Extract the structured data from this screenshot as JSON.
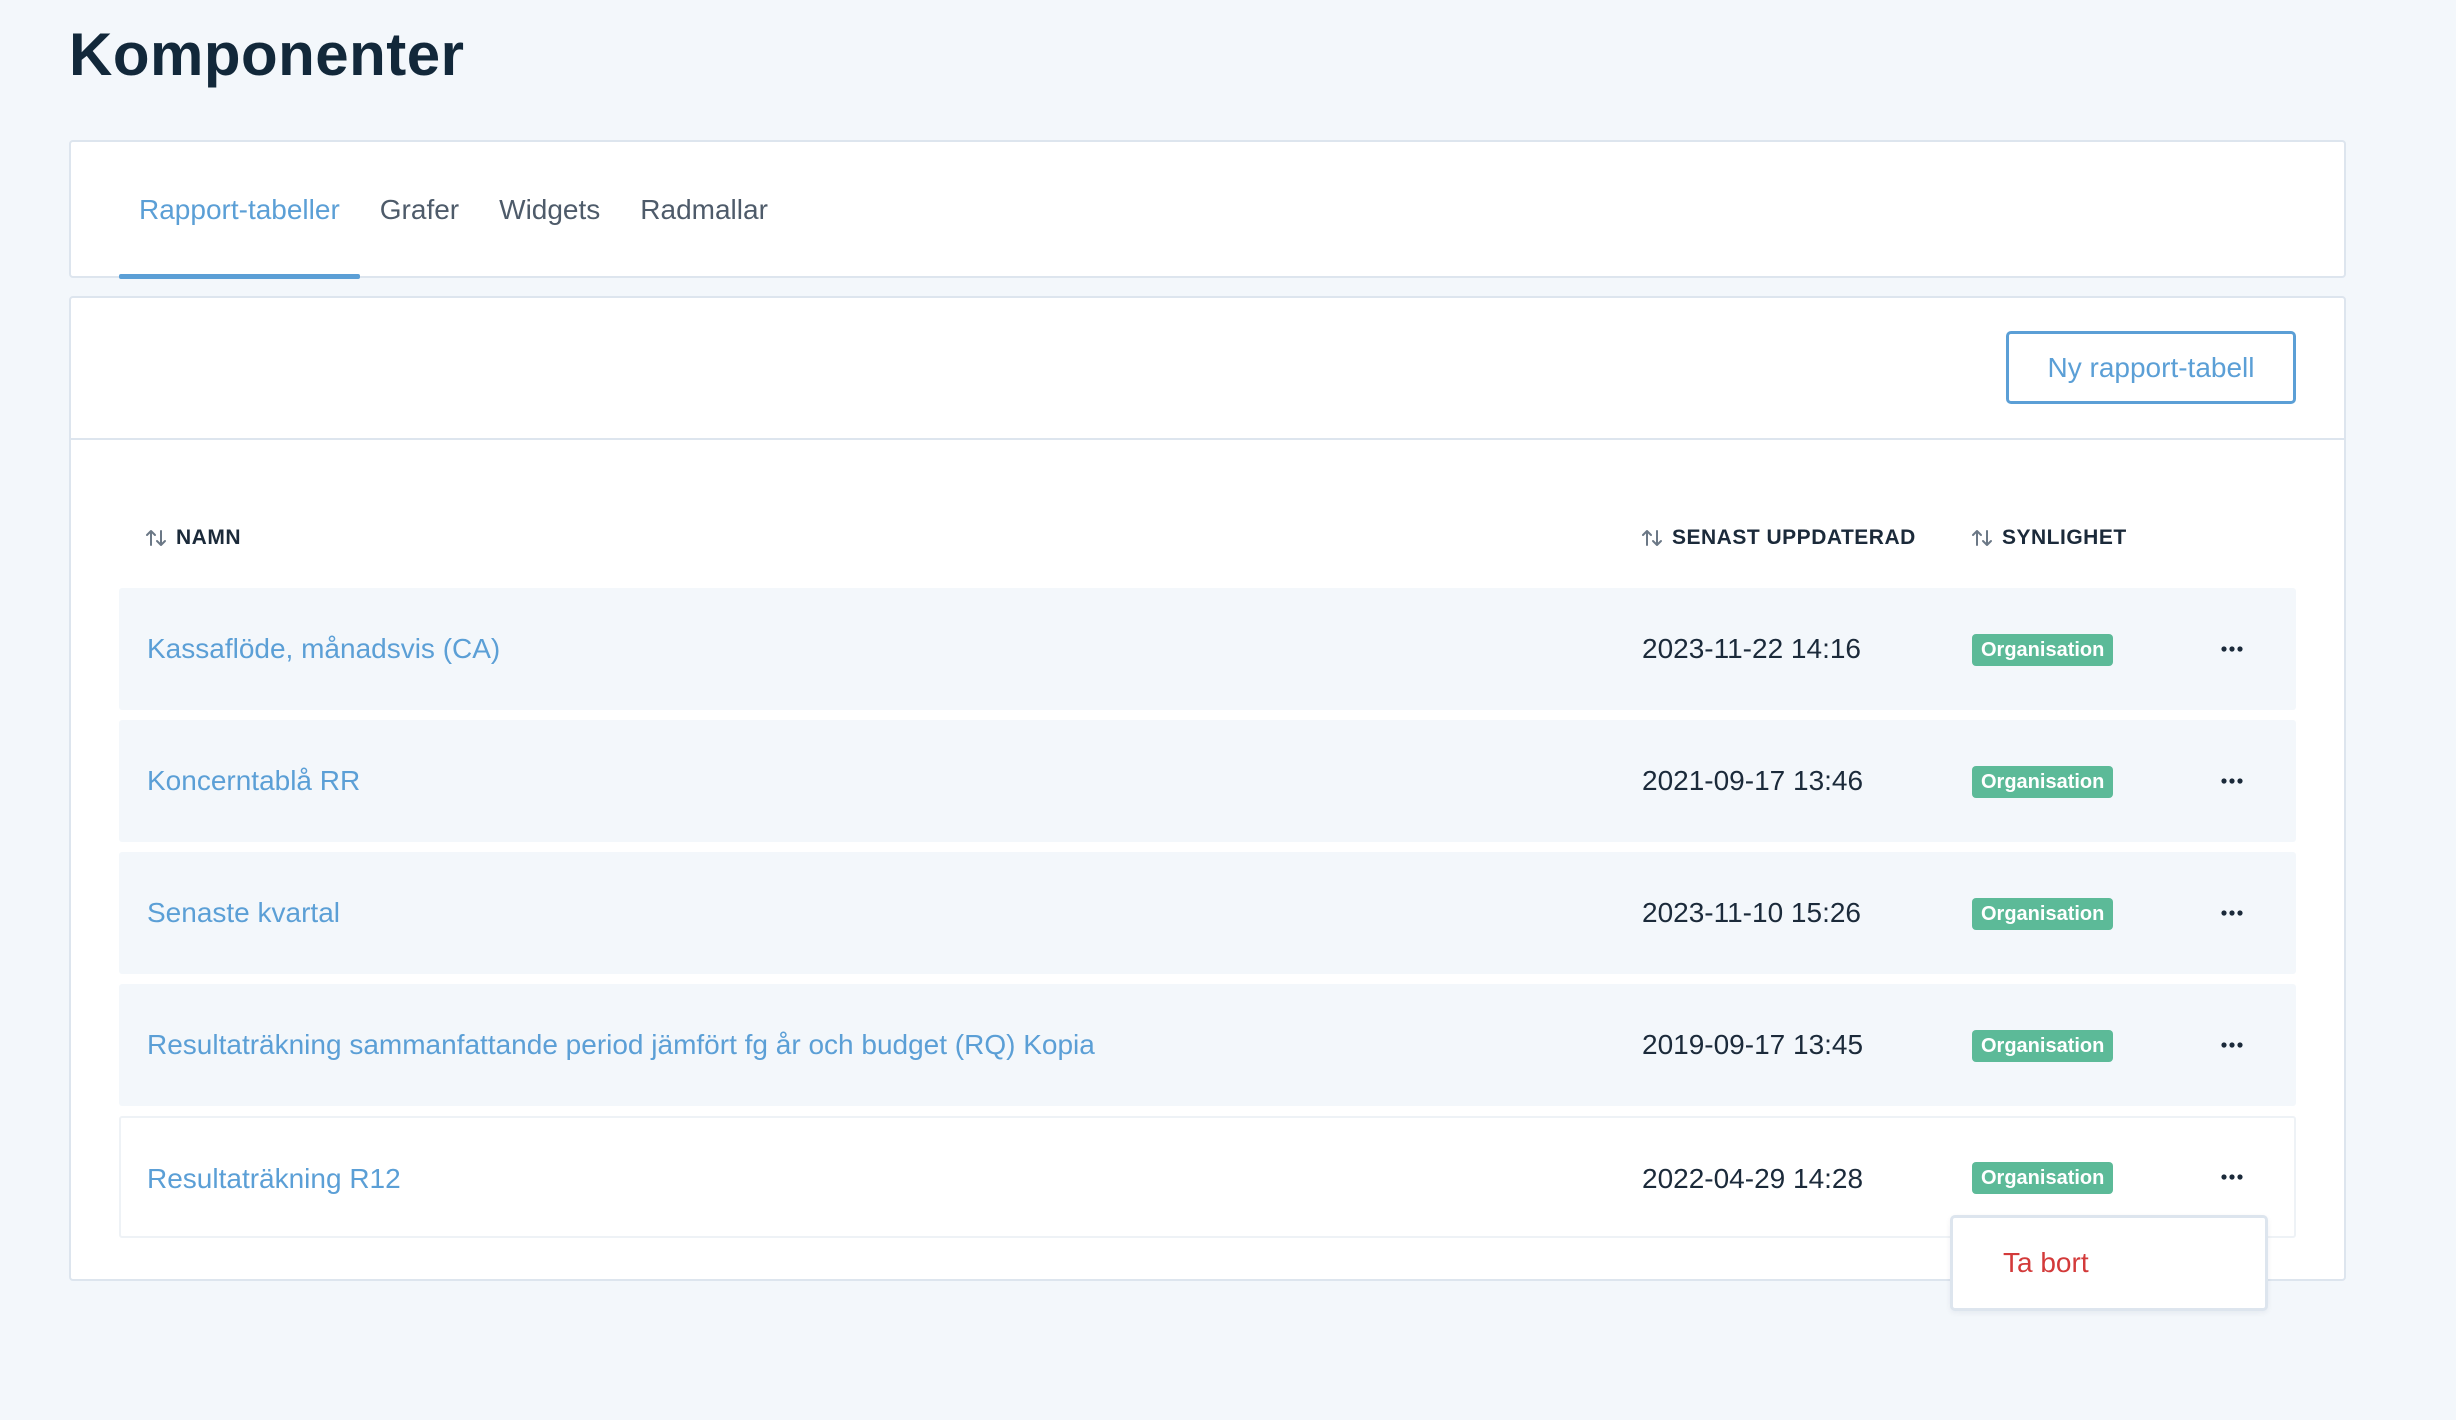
{
  "page": {
    "title": "Komponenter"
  },
  "tabs": [
    {
      "label": "Rapport-tabeller",
      "active": true
    },
    {
      "label": "Grafer",
      "active": false
    },
    {
      "label": "Widgets",
      "active": false
    },
    {
      "label": "Radmallar",
      "active": false
    }
  ],
  "toolbar": {
    "new_button_label": "Ny rapport-tabell"
  },
  "table": {
    "columns": {
      "name": "NAMN",
      "updated": "SENAST UPPDATERAD",
      "visibility": "SYNLIGHET"
    },
    "rows": [
      {
        "name": "Kassaflöde, månadsvis (CA)",
        "updated": "2023-11-22 14:16",
        "visibility": "Organisation"
      },
      {
        "name": "Koncerntablå RR",
        "updated": "2021-09-17 13:46",
        "visibility": "Organisation"
      },
      {
        "name": "Senaste kvartal",
        "updated": "2023-11-10 15:26",
        "visibility": "Organisation"
      },
      {
        "name": "Resultaträkning sammanfattande period jämfört fg år och budget (RQ) Kopia",
        "updated": "2019-09-17 13:45",
        "visibility": "Organisation"
      },
      {
        "name": "Resultaträkning R12",
        "updated": "2022-04-29 14:28",
        "visibility": "Organisation"
      }
    ]
  },
  "row_menu": {
    "delete_label": "Ta bort"
  },
  "icons": {
    "sort": "sort-icon",
    "more": "more-options-icon"
  },
  "colors": {
    "accent": "#5b9fd6",
    "badge": "#5cba98",
    "danger": "#d33a3a",
    "page_background": "#f3f7fb"
  }
}
